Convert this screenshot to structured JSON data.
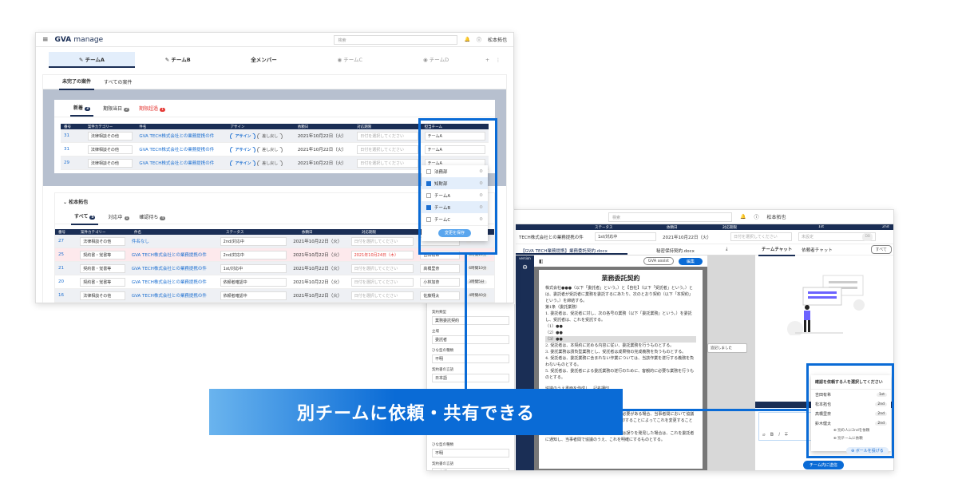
{
  "app": {
    "logo": "GVA",
    "logo_suffix": "manage",
    "search_placeholder": "検索",
    "user": "松本拓也"
  },
  "team_tabs": [
    {
      "label": "チームA",
      "icon": "edit-icon",
      "active": true
    },
    {
      "label": "チームB",
      "icon": "edit-icon"
    },
    {
      "label": "全メンバー"
    },
    {
      "label": "チームC",
      "icon": "eye-icon",
      "muted": true
    },
    {
      "label": "チームD",
      "icon": "eye-icon",
      "muted": true
    }
  ],
  "case_tabs": [
    "未完了の案件",
    "すべての案件"
  ],
  "inbox": {
    "tabs": [
      {
        "label": "新着",
        "count": "3"
      },
      {
        "label": "期限当日",
        "count": "2"
      },
      {
        "label": "期限超過",
        "count": "1"
      }
    ],
    "headers": [
      "番号",
      "案件カテゴリー",
      "件名",
      "アサイン",
      "依頼日",
      "対応期限",
      "担当チーム"
    ],
    "assign_label": "アサイン",
    "return_label": "差し戻し",
    "rows": [
      {
        "no": "31",
        "category": "法律相談その他",
        "title": "GVA TECH株式会社との業務提携の件",
        "date": "2021年10月22日（火）",
        "deadline": "日付を選択してください",
        "team": "チームA"
      },
      {
        "no": "31",
        "category": "法律相談その他",
        "title": "GVA TECH株式会社との業務提携の件",
        "date": "2021年10月22日（火）",
        "deadline": "日付を選択してください",
        "team": "チームA"
      },
      {
        "no": "29",
        "category": "法律相談その他",
        "title": "GVA TECH株式会社との業務提携の件",
        "date": "2021年10月22日（火）",
        "deadline": "日付を選択してください",
        "team": "チームA"
      }
    ]
  },
  "team_dropdown": {
    "options": [
      {
        "label": "法務部",
        "checked": false
      },
      {
        "label": "知財部",
        "checked": true
      },
      {
        "label": "チームA",
        "checked": false
      },
      {
        "label": "チームB",
        "checked": true
      },
      {
        "label": "チームC",
        "checked": false
      }
    ],
    "save_label": "変更を保存"
  },
  "member": {
    "name": "松本拓也",
    "tabs": [
      {
        "label": "すべて",
        "count": "5"
      },
      {
        "label": "対応中",
        "count": "1"
      },
      {
        "label": "確認待ち",
        "count": "4"
      }
    ],
    "headers": [
      "番号",
      "案件カテゴリー",
      "件名",
      "ステータス",
      "依頼日",
      "対応期限"
    ],
    "rows": [
      {
        "no": "27",
        "category": "法律相談その他",
        "title": "件名なし",
        "status": "2nd/対応中",
        "date": "2021年10月22日（火）",
        "deadline": "日付を選択してください",
        "person": "",
        "time": ""
      },
      {
        "no": "25",
        "category": "契約書・覚書等",
        "title": "GVA TECH株式会社との業務提携の件",
        "status": "2nd/対応中",
        "date": "2021年10月22日（火）",
        "deadline": "2021年10月24日（木）",
        "person": "吉田有希",
        "time": "6時間10分",
        "overdue": true
      },
      {
        "no": "21",
        "category": "契約書・覚書等",
        "title": "GVA TECH株式会社との業務提携の件",
        "status": "1st/対応中",
        "date": "2021年10月22日（火）",
        "deadline": "日付を選択してください",
        "person": "高橋里奈",
        "time": "6時間10分"
      },
      {
        "no": "20",
        "category": "契約書・覚書等",
        "title": "GVA TECH株式会社との業務提携の件",
        "status": "依頼者確認中",
        "date": "2021年10月22日（火）",
        "deadline": "日付を選択してください",
        "person": "小林加奈",
        "time": "3時間5分"
      },
      {
        "no": "16",
        "category": "法律相談その他",
        "title": "GVA TECH株式会社との業務提携の件",
        "status": "依頼者確認中",
        "date": "2021年10月22日（火）",
        "deadline": "日付を選択してください",
        "person": "佐藤翔太",
        "time": "4時間40分"
      }
    ]
  },
  "detail": {
    "headers": [
      "ステータス",
      "依頼日",
      "対応期限",
      "1st",
      "2nd"
    ],
    "row": {
      "title": "TECH株式会社との業務提携の件",
      "status": "1st/対応中",
      "date": "2021年10月22日（火）",
      "deadline": "日付を選択してください",
      "first": "未設定",
      "first_badge": "DB"
    },
    "doc_tabs": [
      "【GVA TECH業務提携】業務委託契約.docx",
      "秘密保持契約.docx"
    ],
    "gva_assist": "GVA assist",
    "edit": "編集",
    "doc_title": "業務委託契約",
    "doc_lines": [
      "株式会社●●●（以下「委託者」という。）と【自社】（以下「受託者」という。）とは、委託者が受託者に業務を委託するにあたり、次のとおり契約（以下「本契約」という。）を締結する。",
      "第1条（委託業務）",
      "1. 委託者は、受託者に対し、次の各号の業務（以下「委託業務」という。）を委託し、受託者は、これを受託する。",
      "（1）●●",
      "（2）●●",
      "（3）●●",
      "2. 受託者は、本契約に定める内容に従い、委託業務を行うものとする。",
      "3. 委託業務は請負型業務とし、受託者は成果物の完成義務を負うものとする。",
      "4. 受託者は、委託業務に含まれない作業については、当該作業を遂行する義務を負わないものとする。",
      "5. 受託者は、委託者による委託業務の遂行のために、客観的に必要な業務を行うものとする。"
    ],
    "doc_lines_bottom": [
      "協議のうえ書面を作成し、記名押印",
      "ないものとする。",
      "には、協議のうえ追加業務の内容、",
      "仕様等に従い成果物を作成するものとする。",
      "2. 委託者及び受託者は、仕様等を変更する必要がある場合、当事者間において協議のうえ変更点が記載された書面に双方が押印することによってこれを変更することができる。",
      "3. 受託者は、仕様等に疑義を生じた場合又は誤りを発見した場合は、これを委託者に通知し、当事者間で協議のうえ、これを明確にするものとする。"
    ],
    "comment": "追記しました",
    "chat_tabs": [
      "チームチャット",
      "依頼者チャット"
    ],
    "chat_filter": "すべて",
    "form": [
      {
        "label": "契約類型",
        "value": "業務委託契約"
      },
      {
        "label": "立場",
        "value": "委託者"
      },
      {
        "label": "ひな型の種類",
        "value": "不明"
      },
      {
        "label": "契約書の言語",
        "value": "日本語"
      }
    ],
    "form_bottom": [
      {
        "label": "ひな型の種類",
        "value": "不明"
      },
      {
        "label": "契約書の言語",
        "value": "日本語"
      }
    ],
    "side_version": "version"
  },
  "request_popup": {
    "title": "確認を依頼する人を選択してください",
    "people": [
      {
        "name": "吉田有希",
        "role": "1st"
      },
      {
        "name": "松本拓也",
        "role": "2nd"
      },
      {
        "name": "高橋里奈",
        "role": "2nd"
      },
      {
        "name": "鈴木健太",
        "role": "2nd"
      }
    ],
    "options": [
      "別の人に2ndを依頼",
      "別チームに依頼"
    ],
    "pass_label": "ボールを投げる",
    "send_label": "チーム内に送信"
  },
  "banner": "別チームに依頼・共有できる",
  "colors": {
    "accent": "#0a6bd6",
    "navy": "#1a2e55",
    "link": "#1c6fd1",
    "overdue": "#e53935"
  }
}
